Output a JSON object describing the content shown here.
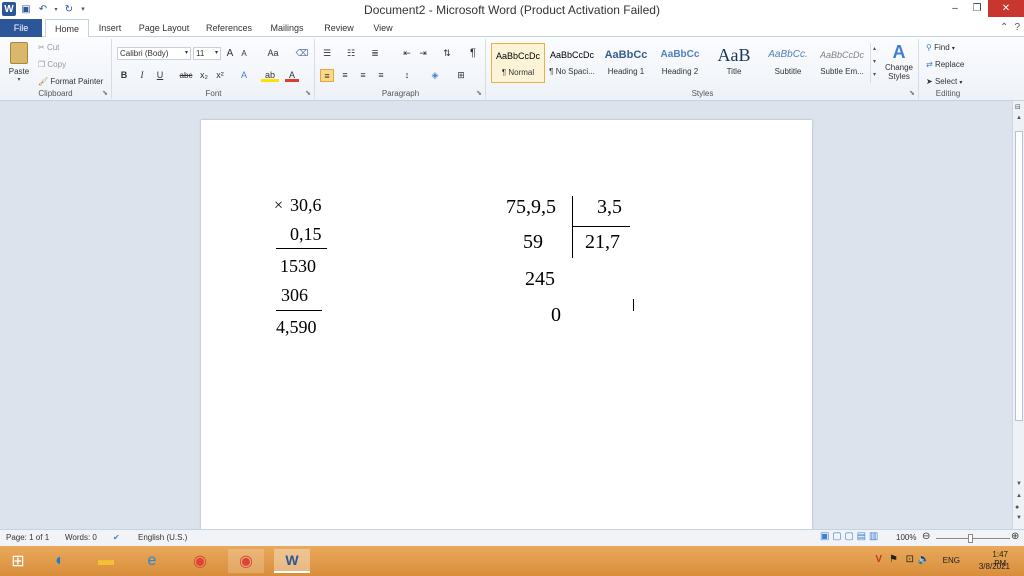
{
  "window": {
    "title": "Document2  -  Microsoft Word (Product Activation Failed)",
    "qat_logo": "W",
    "controls": {
      "minimize": "–",
      "restore": "❐",
      "close": "✕"
    }
  },
  "tabs": [
    "File",
    "Home",
    "Insert",
    "Page Layout",
    "References",
    "Mailings",
    "Review",
    "View"
  ],
  "active_tab": "Home",
  "ribbon": {
    "clipboard": {
      "label": "Clipboard",
      "paste": "Paste",
      "cut": "Cut",
      "copy": "Copy",
      "format_painter": "Format Painter"
    },
    "font": {
      "label": "Font",
      "font_name": "Calibri (Body)",
      "font_size": "11",
      "bold": "B",
      "italic": "I",
      "underline": "U",
      "strike": "abc",
      "subscript": "x₂",
      "superscript": "x²",
      "grow": "A",
      "shrink": "A",
      "change_case": "Aa",
      "text_effects": "A",
      "highlight": "ab",
      "font_color": "A"
    },
    "paragraph": {
      "label": "Paragraph",
      "pilcrow": "¶"
    },
    "styles": {
      "label": "Styles",
      "items": [
        {
          "preview": "AaBbCcDc",
          "name": "¶ Normal"
        },
        {
          "preview": "AaBbCcDc",
          "name": "¶ No Spaci..."
        },
        {
          "preview": "AaBbCc",
          "name": "Heading 1"
        },
        {
          "preview": "AaBbCc",
          "name": "Heading 2"
        },
        {
          "preview": "AaB",
          "name": "Title"
        },
        {
          "preview": "AaBbCc.",
          "name": "Subtitle"
        },
        {
          "preview": "AaBbCcDc",
          "name": "Subtle Em..."
        }
      ],
      "change_styles_line1": "Change",
      "change_styles_line2": "Styles"
    },
    "editing": {
      "label": "Editing",
      "find": "Find",
      "replace": "Replace",
      "select": "Select"
    }
  },
  "document": {
    "multiplication": {
      "symbol": "×",
      "top": "30,6",
      "bottom": "0,15",
      "partial1": "1530",
      "partial2": "306",
      "result": "4,590"
    },
    "division": {
      "dividend": "75,9,5",
      "divisor": "3,5",
      "quotient": "21,7",
      "step1": "59",
      "step2": "245",
      "remainder": "0"
    }
  },
  "status": {
    "page": "Page: 1 of 1",
    "words": "Words: 0",
    "language": "English (U.S.)",
    "zoom": "100%"
  },
  "taskbar": {
    "language": "ENG",
    "time": "1:47 PM",
    "date": "3/8/2021"
  }
}
